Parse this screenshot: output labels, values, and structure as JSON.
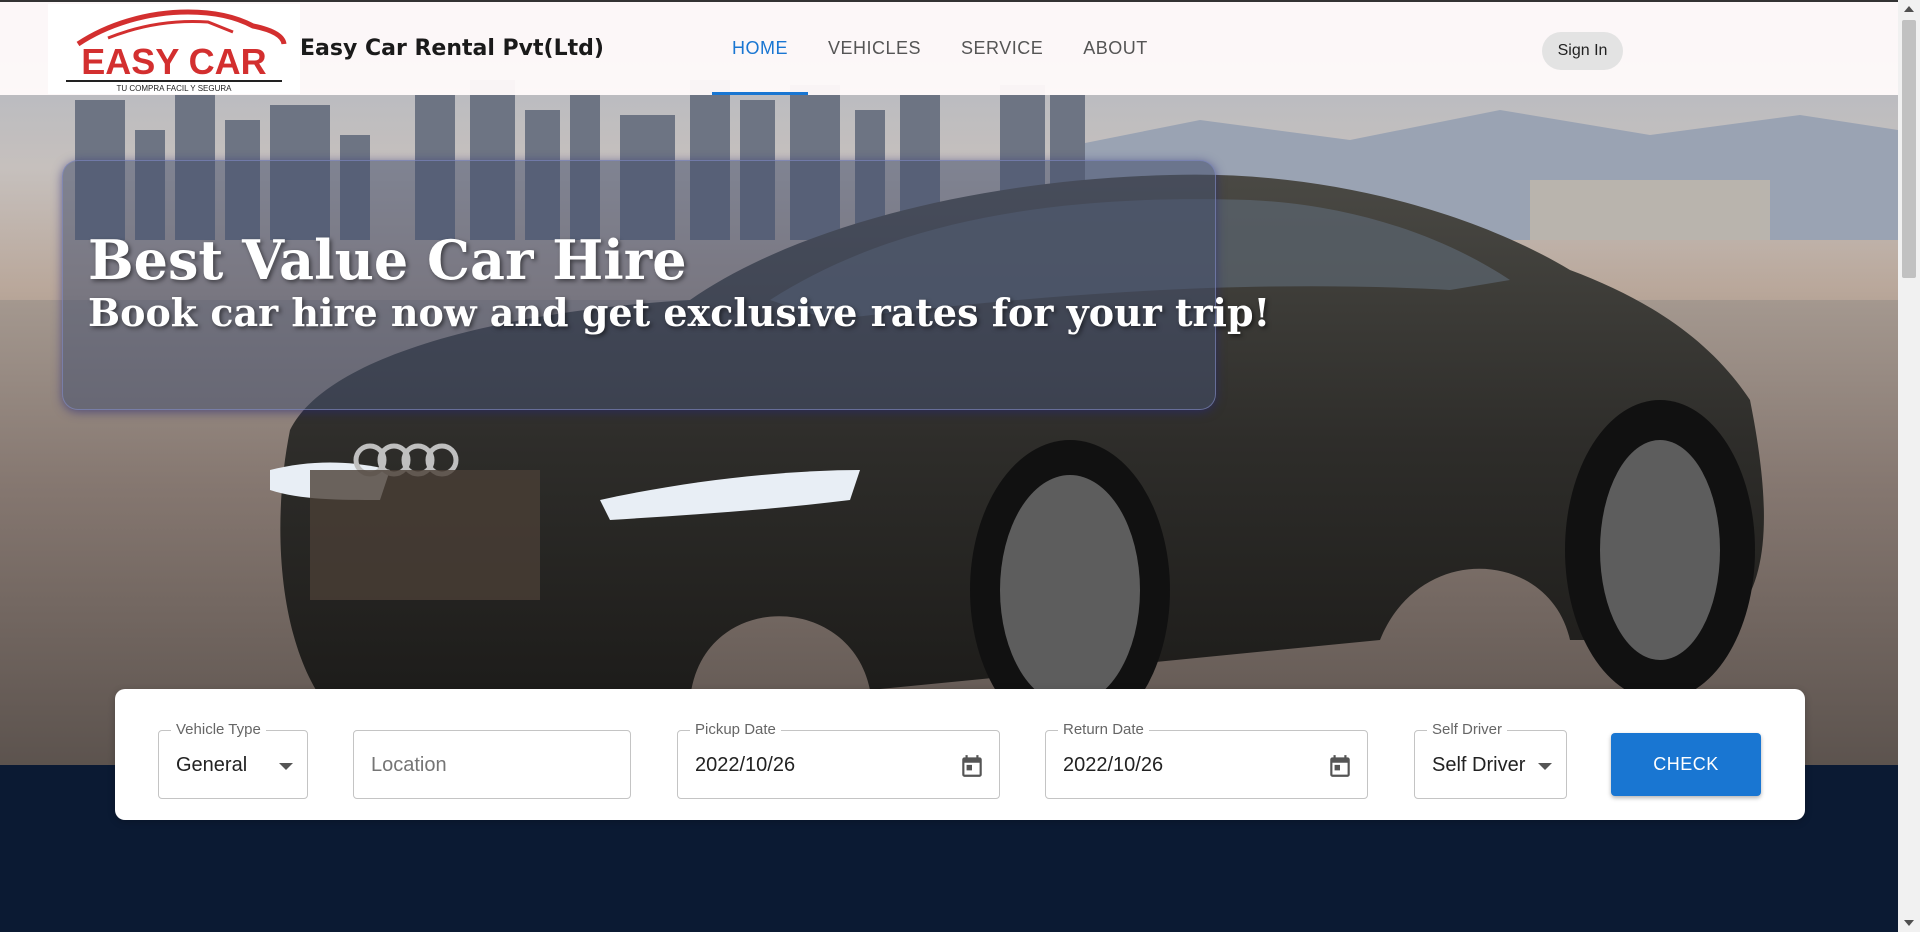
{
  "header": {
    "logo": {
      "brand": "EASY CAR",
      "tagline": "TU COMPRA FACIL Y SEGURA"
    },
    "company_name": "Easy Car Rental Pvt(Ltd)",
    "nav": [
      {
        "label": "HOME",
        "active": true
      },
      {
        "label": "VEHICLES",
        "active": false
      },
      {
        "label": "SERVICE",
        "active": false
      },
      {
        "label": "ABOUT",
        "active": false
      }
    ],
    "signin_label": "Sign In"
  },
  "hero": {
    "headline": "Best Value Car Hire",
    "subline": "Book car hire now and get exclusive rates for your trip!",
    "image": "black-electric-sedan-city-skyline"
  },
  "search": {
    "vehicle_type": {
      "label": "Vehicle Type",
      "value": "General",
      "icon": "arrow-drop-down-icon"
    },
    "location": {
      "placeholder": "Location"
    },
    "pickup_date": {
      "label": "Pickup Date",
      "value": "2022/10/26",
      "icon": "calendar-icon"
    },
    "return_date": {
      "label": "Return Date",
      "value": "2022/10/26",
      "icon": "calendar-icon"
    },
    "self_driver": {
      "label": "Self Driver",
      "value": "Self Driver",
      "icon": "arrow-drop-down-icon"
    },
    "check_label": "CHECK"
  },
  "colors": {
    "accent": "#1976d2",
    "footer_bg": "#0b1a33",
    "logo_red": "#d32f2f"
  }
}
